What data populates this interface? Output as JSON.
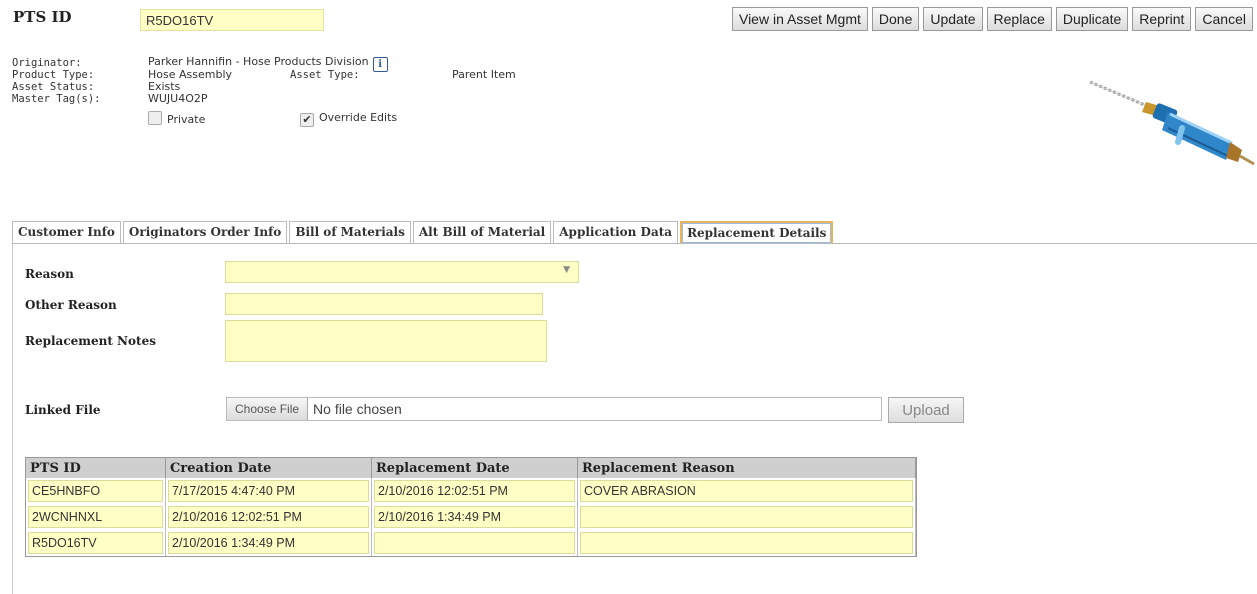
{
  "header": {
    "pts_label": "PTS ID",
    "pts_value": "R5DO16TV",
    "buttons": [
      "View in Asset Mgmt",
      "Done",
      "Update",
      "Replace",
      "Duplicate",
      "Reprint",
      "Cancel"
    ]
  },
  "meta": {
    "originator_label": "Originator:",
    "originator_value": "Parker Hannifin - Hose Products Division",
    "product_type_label": "Product Type:",
    "product_type_value": "Hose Assembly",
    "asset_type_label": "Asset Type:",
    "asset_type_value": "Parent Item",
    "asset_status_label": "Asset Status:",
    "asset_status_value": "Exists",
    "master_tags_label": "Master Tag(s):",
    "master_tags_value": "WUJU4O2P",
    "private_label": "Private",
    "private_checked": false,
    "override_label": "Override Edits",
    "override_checked": true
  },
  "tabs": [
    "Customer Info",
    "Originators Order Info",
    "Bill of Materials",
    "Alt Bill of Material",
    "Application Data",
    "Replacement Details"
  ],
  "active_tab": "Replacement Details",
  "form": {
    "reason_label": "Reason",
    "reason_value": "",
    "other_reason_label": "Other Reason",
    "other_reason_value": "",
    "notes_label": "Replacement Notes",
    "notes_value": "",
    "linked_file_label": "Linked File",
    "choose_file_label": "Choose File",
    "no_file_text": "No file chosen",
    "upload_label": "Upload"
  },
  "table": {
    "headers": [
      "PTS ID",
      "Creation Date",
      "Replacement Date",
      "Replacement Reason"
    ],
    "rows": [
      [
        "CE5HNBFO",
        "7/17/2015 4:47:40 PM",
        "2/10/2016 12:02:51 PM",
        "COVER ABRASION"
      ],
      [
        "2WCNHNXL",
        "2/10/2016 12:02:51 PM",
        "2/10/2016 1:34:49 PM",
        ""
      ],
      [
        "R5DO16TV",
        "2/10/2016 1:34:49 PM",
        "",
        ""
      ]
    ]
  },
  "colors": {
    "field_yellow": "#ffffc5",
    "header_gray": "#cfcfcf",
    "active_tab_border": "#e8b65a",
    "hose_blue": "#2f86c8"
  },
  "icons": {
    "info": "info-icon",
    "product": "hose-assembly-image"
  }
}
